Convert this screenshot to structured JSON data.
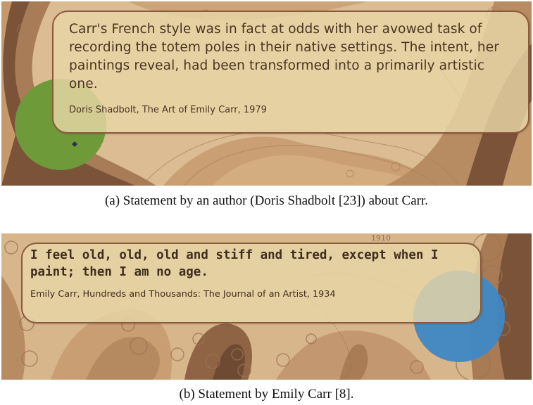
{
  "panel_a": {
    "quote": "Carr's French style was in fact at odds with her avowed task of recording the totem poles in their native settings. The intent, her paintings reveal, had been transformed into a primarily artistic one.",
    "attribution": "Doris Shadbolt, The Art of Emily Carr, 1979",
    "caption": "(a)  Statement by an author (Doris Shadbolt [23]) about Carr."
  },
  "panel_b": {
    "year_label": "1910",
    "quote": "I feel old, old, old and stiff and tired, except when I paint; then I am no age.",
    "attribution": "Emily Carr, Hundreds and Thousands: The Journal of an Artist, 1934",
    "caption": "(b)  Statement by Emily Carr [8]."
  },
  "colors": {
    "green_marker": "#6e9a3a",
    "blue_marker": "#3f88c5",
    "box_border": "#8a5a3e"
  }
}
